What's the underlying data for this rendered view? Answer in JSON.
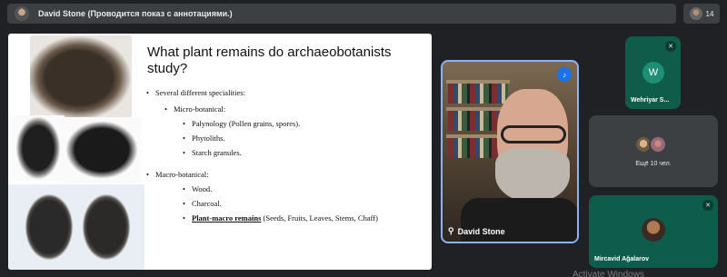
{
  "topbar": {
    "presenter_title": "David Stone (Проводится показ с аннотациями.)",
    "participants_count": "14"
  },
  "slide": {
    "title": "What plant remains do archaeobotanists study?",
    "bullets": {
      "intro": "Several different specialities:",
      "micro": "Micro-botanical:",
      "micro_items": [
        "Palynology (Pollen grains, spores).",
        "Phytoliths.",
        "Starch granules."
      ],
      "macro": "Macro-botanical:",
      "macro_items": [
        "Wood.",
        "Charcoal."
      ],
      "macro_emph": "Plant-macro remains",
      "macro_emph_rest": " (Seeds, Fruits, Leaves, Stems, Chaff)"
    }
  },
  "main_video": {
    "name": "David Stone"
  },
  "tiles": {
    "w": {
      "initial": "W",
      "label": "Wehriyar S..."
    },
    "others": {
      "label": "Ещё 10 чел."
    },
    "mirc": {
      "label": "Mircavid Ağalarov"
    }
  },
  "watermark": "Activate Windows",
  "icons": [
    "presenter-avatar",
    "people-icon",
    "mic-off-icon",
    "speaking-icon",
    "pin-icon"
  ]
}
